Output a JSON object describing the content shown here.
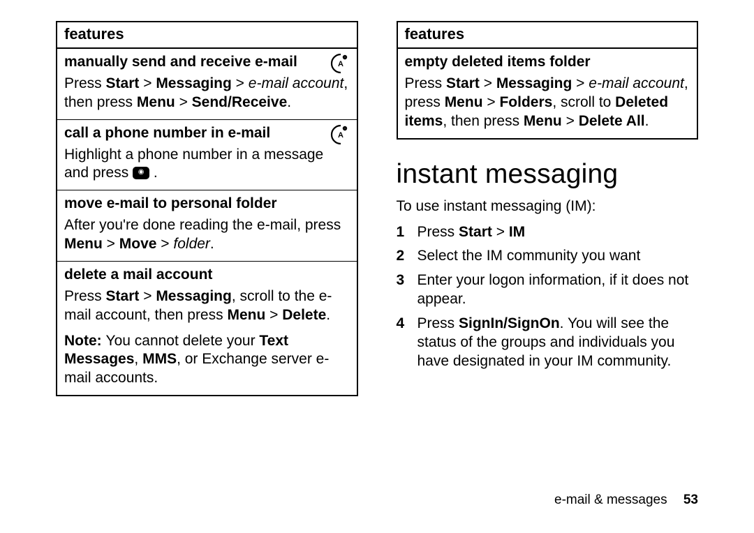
{
  "left": {
    "header": "features",
    "rows": {
      "r1": {
        "title": "manually send and receive e-mail",
        "press1": "Press ",
        "seg1b": "Start",
        "seg1c": " > ",
        "seg1d": "Messaging",
        "seg1e": " > ",
        "seg1f": "e-mail account",
        "seg1g": ", then press ",
        "seg1h": "Menu",
        "seg1i": " > ",
        "seg1j": "Send/Receive",
        "seg1k": "."
      },
      "r2": {
        "title": "call a phone number in e-mail",
        "body_a": "Highlight a phone number in a message and press ",
        "body_b": " ."
      },
      "r3": {
        "title": "move e-mail to personal folder",
        "a": "After you're done reading the e-mail, press ",
        "b": "Menu",
        "c": " > ",
        "d": "Move",
        "e": " > ",
        "f": "folder",
        "g": "."
      },
      "r4": {
        "title": "delete a mail account",
        "a": "Press ",
        "b": "Start",
        "c": " > ",
        "d": "Messaging",
        "e": ", scroll to the e-mail account, then press ",
        "f": "Menu",
        "g": " > ",
        "h": "Delete",
        "i": ".",
        "note_lead": "Note: ",
        "note_a": "You cannot delete your ",
        "note_b": "Text Messages",
        "note_c": ", ",
        "note_d": "MMS",
        "note_e": ", or Exchange server e-mail accounts."
      }
    }
  },
  "right": {
    "header": "features",
    "r1": {
      "title": "empty deleted items folder",
      "a": "Press ",
      "b": "Start",
      "c": " > ",
      "d": "Messaging",
      "e": " > ",
      "f": "e-mail account",
      "g": ", press ",
      "h": "Menu",
      "i": " > ",
      "j": "Folders",
      "k": ", scroll to ",
      "l": "Deleted items",
      "m": ", then press ",
      "n": "Menu",
      "o": " > ",
      "p": "Delete All",
      "q": "."
    },
    "section_title": "instant messaging",
    "intro": "To use instant messaging (IM):",
    "steps": {
      "s1n": "1",
      "s1a": "Press ",
      "s1b": "Start",
      "s1c": " > ",
      "s1d": "IM",
      "s2n": "2",
      "s2": "Select the IM community you want",
      "s3n": "3",
      "s3": "Enter your logon information, if it does not appear.",
      "s4n": "4",
      "s4a": "Press ",
      "s4b": "SignIn/SignOn",
      "s4c": ". You will see the status of the groups and individuals you have designated in your IM community."
    }
  },
  "footer": {
    "text": "e-mail & messages",
    "page": "53"
  }
}
